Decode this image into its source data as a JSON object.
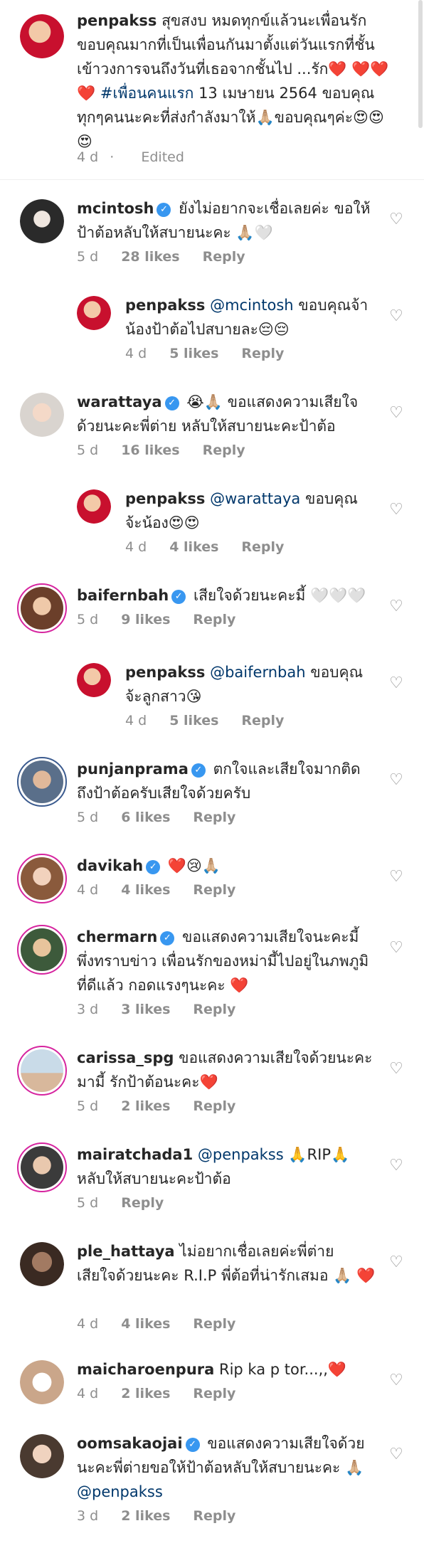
{
  "post": {
    "username": "penpakss",
    "caption": "สุขสงบ หมดทุกข์แล้วนะเพื่อนรัก ขอบคุณมากที่เป็นเพื่อนกันมาตั้งแต่วันแรกที่ชั้นเข้าวงการจนถึงวันที่เธอจากชั้นไป ...รัก❤️ ❤️❤️❤️",
    "hashtag": "#เพื่อนคนแรก",
    "caption_2": "13 เมษายน 2564 ขอบคุณทุกๆคนนะคะที่ส่งกำลังมาให้🙏🏼ขอบคุณๆค่ะ😍😍😍",
    "time": "4 d",
    "edited": "Edited"
  },
  "comments": [
    {
      "username": "mcintosh",
      "verified": true,
      "text": "ยังไม่อยากจะเชื่อเลยค่ะ ขอให้ป้าต้อหลับให้สบายนะคะ 🙏🏼🤍",
      "time": "5 d",
      "likes": "28 likes",
      "reply": "Reply"
    },
    {
      "username": "penpakss",
      "mention": "@mcintosh",
      "text": "ขอบคุณจ้าน้องป้าต้อไปสบายละ😔😔",
      "time": "4 d",
      "likes": "5 likes",
      "reply": "Reply"
    },
    {
      "username": "warattaya",
      "verified": true,
      "text": "😭🙏🏼 ขอแสดงความเสียใจด้วยนะคะพี่ต่าย หลับให้สบายนะคะป้าต้อ",
      "time": "5 d",
      "likes": "16 likes",
      "reply": "Reply"
    },
    {
      "username": "penpakss",
      "mention": "@warattaya",
      "text": "ขอบคุณจ้ะน้อง😍😍",
      "time": "4 d",
      "likes": "4 likes",
      "reply": "Reply"
    },
    {
      "username": "baifernbah",
      "verified": true,
      "text": "เสียใจด้วยนะคะมี้ 🤍🤍🤍",
      "time": "5 d",
      "likes": "9 likes",
      "reply": "Reply"
    },
    {
      "username": "penpakss",
      "mention": "@baifernbah",
      "text": "ขอบคุณจ้ะลูกสาว😘",
      "time": "4 d",
      "likes": "5 likes",
      "reply": "Reply"
    },
    {
      "username": "punjanprama",
      "verified": true,
      "text": "ตกใจและเสียใจมากติดถึงป้าต้อครับเสียใจด้วยครับ",
      "time": "5 d",
      "likes": "6 likes",
      "reply": "Reply"
    },
    {
      "username": "davikah",
      "verified": true,
      "text": "❤️😢🙏🏼",
      "time": "4 d",
      "likes": "4 likes",
      "reply": "Reply"
    },
    {
      "username": "chermarn",
      "verified": true,
      "text": "ขอแสดงความเสียใจนะคะมี้ พึ่งทราบข่าว เพื่อนรักของหม่ามี้ไปอยู่ในภพภูมิที่ดีแล้ว กอดแรงๆนะคะ ❤️",
      "time": "3 d",
      "likes": "3 likes",
      "reply": "Reply"
    },
    {
      "username": "carissa_spg",
      "verified": false,
      "text": "ขอแสดงความเสียใจด้วยนะคะมามี้ รักป้าต้อนะคะ❤️",
      "time": "5 d",
      "likes": "2 likes",
      "reply": "Reply"
    },
    {
      "username": "mairatchada1",
      "verified": false,
      "mention": "@penpakss",
      "text": "🙏RIP🙏 หลับให้สบายนะคะป้าต้อ",
      "time": "5 d",
      "likes": "",
      "reply": "Reply"
    },
    {
      "username": "ple_hattaya",
      "verified": false,
      "text": "ไม่อยากเชื่อเลยค่ะพี่ต่าย เสียใจด้วยนะคะ R.I.P พี่ต้อที่น่ารักเสมอ 🙏🏼 ❤️",
      "time": "4 d",
      "likes": "4 likes",
      "reply": "Reply"
    },
    {
      "username": "maicharoenpura",
      "verified": false,
      "text": "Rip ka p tor...,,❤️",
      "time": "4 d",
      "likes": "2 likes",
      "reply": "Reply"
    },
    {
      "username": "oomsakaojai",
      "verified": true,
      "text": "ขอแสดงความเสียใจด้วยนะคะพี่ต่ายขอให้ป้าต้อหลับให้สบายนะคะ 🙏🏼",
      "mention_end": "@penpakss",
      "time": "3 d",
      "likes": "2 likes",
      "reply": "Reply"
    }
  ],
  "icons": {
    "heart": "heart-outline-icon",
    "verified": "verified-badge-icon"
  },
  "colors": {
    "verified": "#3897f0",
    "mention": "#00376b",
    "meta": "#8e8e8e",
    "story_ring": "#d6249f"
  }
}
